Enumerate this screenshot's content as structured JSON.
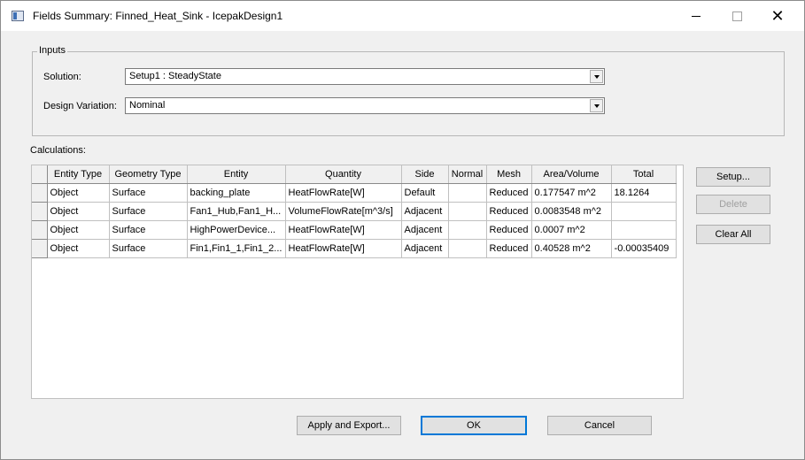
{
  "window": {
    "title": "Fields Summary: Finned_Heat_Sink - IcepakDesign1",
    "minimize_glyph": "",
    "maximize_glyph": "",
    "close_glyph": "✕"
  },
  "inputs": {
    "legend": "Inputs",
    "solution_label": "Solution:",
    "solution_value": "Setup1 : SteadyState",
    "variation_label": "Design Variation:",
    "variation_value": "Nominal"
  },
  "calculations": {
    "label": "Calculations:",
    "columns": [
      "Entity Type",
      "Geometry Type",
      "Entity",
      "Quantity",
      "Side",
      "Normal",
      "Mesh",
      "Area/Volume",
      "Total"
    ],
    "rows": [
      [
        "Object",
        "Surface",
        "backing_plate",
        "HeatFlowRate[W]",
        "Default",
        "",
        "Reduced",
        "0.177547 m^2",
        "18.1264"
      ],
      [
        "Object",
        "Surface",
        "Fan1_Hub,Fan1_H...",
        "VolumeFlowRate[m^3/s]",
        "Adjacent",
        "",
        "Reduced",
        "0.0083548 m^2",
        ""
      ],
      [
        "Object",
        "Surface",
        "HighPowerDevice...",
        "HeatFlowRate[W]",
        "Adjacent",
        "",
        "Reduced",
        "0.0007 m^2",
        ""
      ],
      [
        "Object",
        "Surface",
        "Fin1,Fin1_1,Fin1_2...",
        "HeatFlowRate[W]",
        "Adjacent",
        "",
        "Reduced",
        "0.40528 m^2",
        "-0.00035409"
      ]
    ]
  },
  "side_buttons": {
    "setup": "Setup...",
    "delete": "Delete",
    "clear_all": "Clear All"
  },
  "footer": {
    "apply_export": "Apply and Export...",
    "ok": "OK",
    "cancel": "Cancel"
  }
}
